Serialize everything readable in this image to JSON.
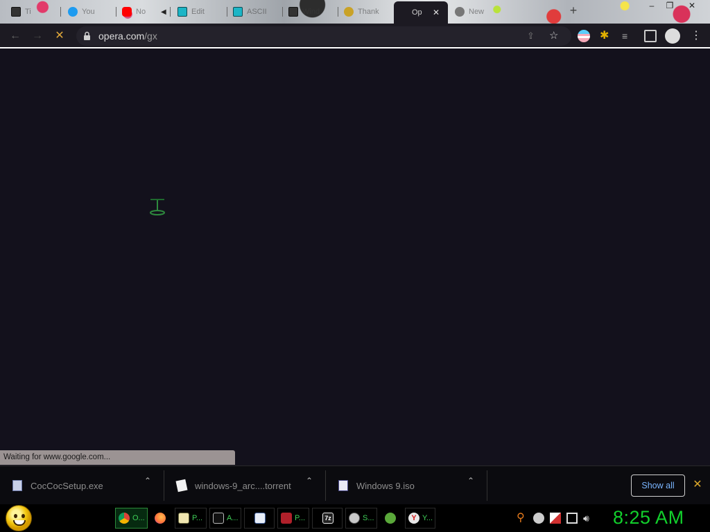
{
  "browser": {
    "tabs": [
      {
        "label": "Ti",
        "icon": "archive-icon"
      },
      {
        "label": "You",
        "icon": "twitter-icon"
      },
      {
        "label": "No",
        "icon": "youtube-icon"
      },
      {
        "label": "Edit",
        "icon": "app-icon"
      },
      {
        "label": "ASCII",
        "icon": "app-icon"
      },
      {
        "label": "Wind",
        "icon": "archive-icon"
      },
      {
        "label": "Thank",
        "icon": "site-icon"
      },
      {
        "label": "Op",
        "icon": "site-icon",
        "active": true
      },
      {
        "label": "New",
        "icon": "chrome-icon"
      }
    ],
    "address": {
      "domain": "opera.com",
      "path": "/gx"
    },
    "status_text": "Waiting for www.google.com..."
  },
  "downloads": {
    "items": [
      {
        "name": "CocCocSetup.exe",
        "icon": "installer-icon"
      },
      {
        "name": "windows-9_arc....torrent",
        "icon": "file-icon"
      },
      {
        "name": "Windows 9.iso",
        "icon": "iso-icon"
      }
    ],
    "show_all_label": "Show all"
  },
  "taskbar": {
    "apps": [
      {
        "label": "O...",
        "icon": "chrome-icon"
      },
      {
        "label": "",
        "icon": "firefox-icon"
      },
      {
        "label": "P...",
        "icon": "notepad-icon"
      },
      {
        "label": "A...",
        "icon": "terminal-icon"
      },
      {
        "label": "",
        "icon": "document-icon"
      },
      {
        "label": "P...",
        "icon": "pdf-icon"
      },
      {
        "label": "",
        "icon": "7zip-icon"
      },
      {
        "label": "S...",
        "icon": "settings-icon"
      },
      {
        "label": "",
        "icon": "refresh-icon"
      },
      {
        "label": "Y...",
        "icon": "yandex-icon"
      }
    ],
    "clock": "8:25 AM"
  },
  "colors": {
    "background": "#13111c",
    "accent_green": "#12d02c",
    "link_blue": "#7ab5ff",
    "close_orange": "#d9a62a"
  }
}
